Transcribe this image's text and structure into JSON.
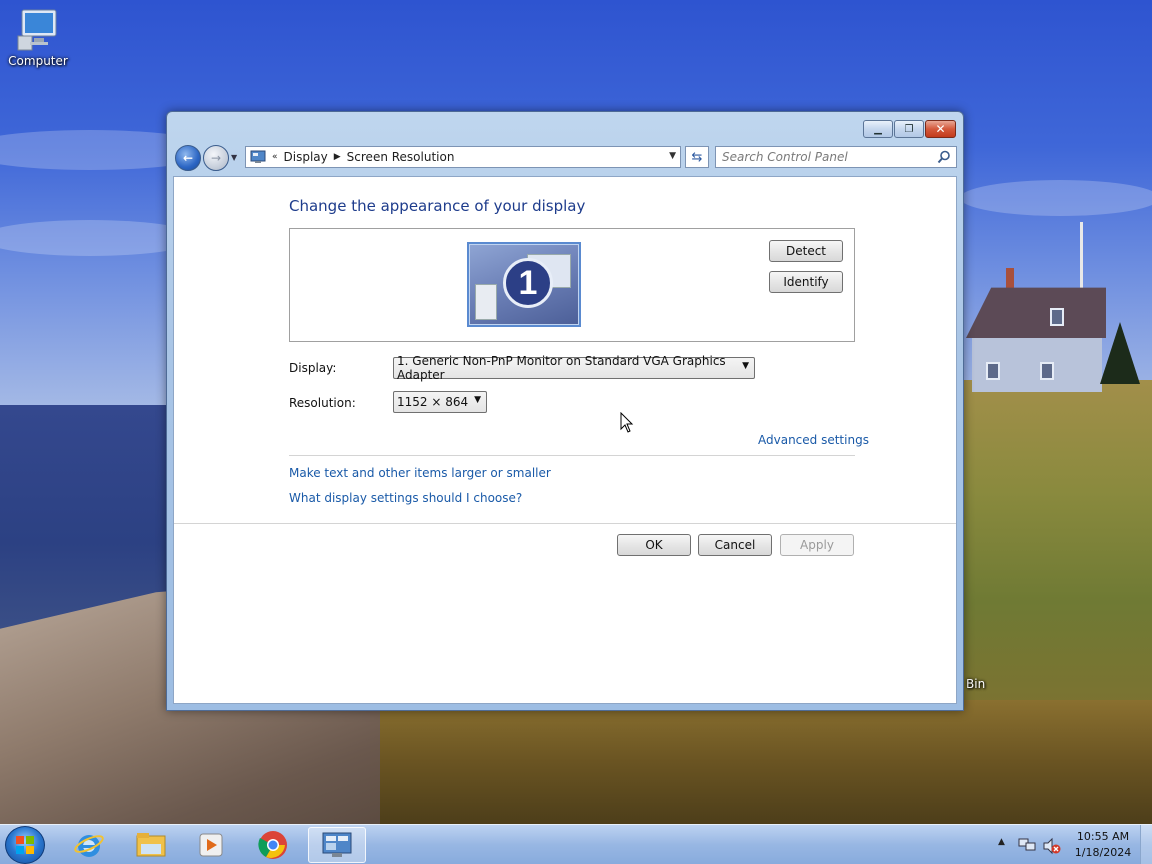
{
  "desktop": {
    "icons": [
      {
        "label": "Computer"
      }
    ],
    "recycle_bin_partial_label": "Bin"
  },
  "window": {
    "caption_buttons": {
      "minimize": "minimize",
      "maximize": "maximize",
      "close": "close"
    },
    "breadcrumb": {
      "overflow": "«",
      "items": [
        "Display",
        "Screen Resolution"
      ]
    },
    "search": {
      "placeholder": "Search Control Panel"
    },
    "heading": "Change the appearance of your display",
    "monitor_number": "1",
    "buttons": {
      "detect": "Detect",
      "identify": "Identify",
      "ok": "OK",
      "cancel": "Cancel",
      "apply": "Apply"
    },
    "display": {
      "label": "Display:",
      "value": "1. Generic Non-PnP Monitor on Standard VGA Graphics Adapter"
    },
    "resolution": {
      "label": "Resolution:",
      "value": "1152 × 864"
    },
    "links": {
      "advanced": "Advanced settings",
      "text_size": "Make text and other items larger or smaller",
      "help": "What display settings should I choose?"
    }
  },
  "taskbar": {
    "apps": [
      "start",
      "internet-explorer",
      "windows-explorer",
      "media-player",
      "chrome",
      "control-panel"
    ],
    "active_app": "control-panel",
    "clock": {
      "time": "10:55 AM",
      "date": "1/18/2024"
    }
  },
  "colors": {
    "heading": "#1e3c8c",
    "link": "#1a5aa8",
    "close_button": "#c23a1c"
  }
}
